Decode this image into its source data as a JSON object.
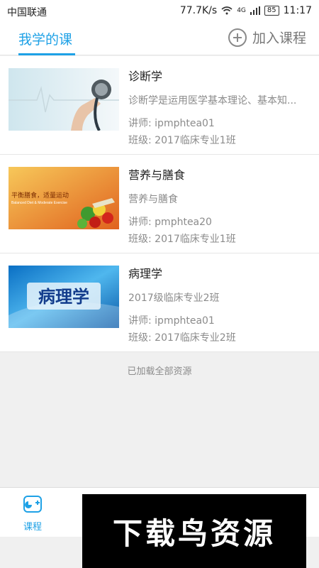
{
  "status_bar": {
    "carrier": "中国联通",
    "speed": "77.7K/s",
    "network": "4G",
    "battery": "85",
    "time": "11:17"
  },
  "header": {
    "tab_label": "我学的课",
    "join_label": "加入课程"
  },
  "courses": [
    {
      "title": "诊断学",
      "description": "诊断学是运用医学基本理论、基本知...",
      "teacher": "讲师: ipmphtea01",
      "class": "班级: 2017临床专业1班"
    },
    {
      "title": "营养与膳食",
      "description": "营养与膳食",
      "teacher": "讲师: pmphtea20",
      "class": "班级: 2017临床专业1班",
      "thumb_caption": "平衡膳食，适量运动",
      "thumb_caption_en": "Balanced Diet & Moderate Exercise"
    },
    {
      "title": "病理学",
      "description": "2017级临床专业2班",
      "teacher": "讲师: ipmphtea01",
      "class": "班级: 2017临床专业2班",
      "thumb_caption": "病理学"
    }
  ],
  "list_footer": "已加载全部资源",
  "bottom_nav": {
    "course_label": "课程"
  },
  "watermark": "下载鸟资源",
  "colors": {
    "accent": "#1ea1e6",
    "text_secondary": "#8b8b8b"
  }
}
